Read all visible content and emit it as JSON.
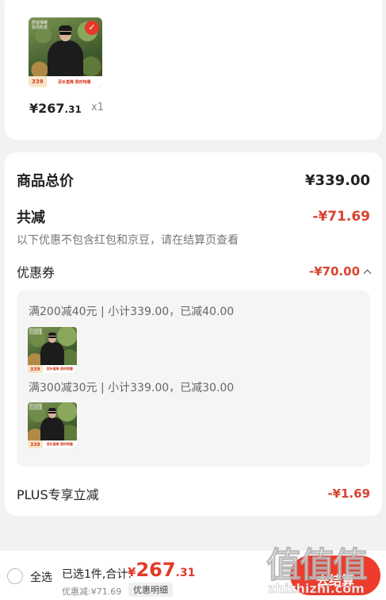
{
  "item": {
    "thumb_price": "339",
    "thumb_tag": "舒适保暖 抗风防泼",
    "thumb_banner": "百补直降 限时特惠",
    "price_main": "¥267",
    "price_cents": ".31",
    "quantity": "x1"
  },
  "summary": {
    "total_label": "商品总价",
    "total_value": "¥339.00",
    "reduce_label": "共减",
    "reduce_value": "-¥71.69",
    "note": "以下优惠不包含红包和京豆，请在结算页查看",
    "coupon_label": "优惠券",
    "coupon_value": "-¥70.00",
    "coupon_lines": [
      "满200减40元 | 小计339.00，已减40.00",
      "满300减30元 | 小计339.00，已减30.00"
    ],
    "plus_label": "PLUS专享立减",
    "plus_value": "-¥1.69"
  },
  "bottom": {
    "select_all": "全选",
    "selected_text": "已选1件,合计:",
    "total_yen": "¥",
    "total_int": "267",
    "total_dec": ".31",
    "discount_text": "优惠减:¥71.69",
    "discount_detail": "优惠明细",
    "checkout": "去结算"
  },
  "watermark": {
    "glyphs": "值值值",
    "url": "zhizhizhi.com"
  },
  "colors": {
    "accent": "#e4392b",
    "discount": "#d8432f",
    "background": "#f2f2f2"
  }
}
